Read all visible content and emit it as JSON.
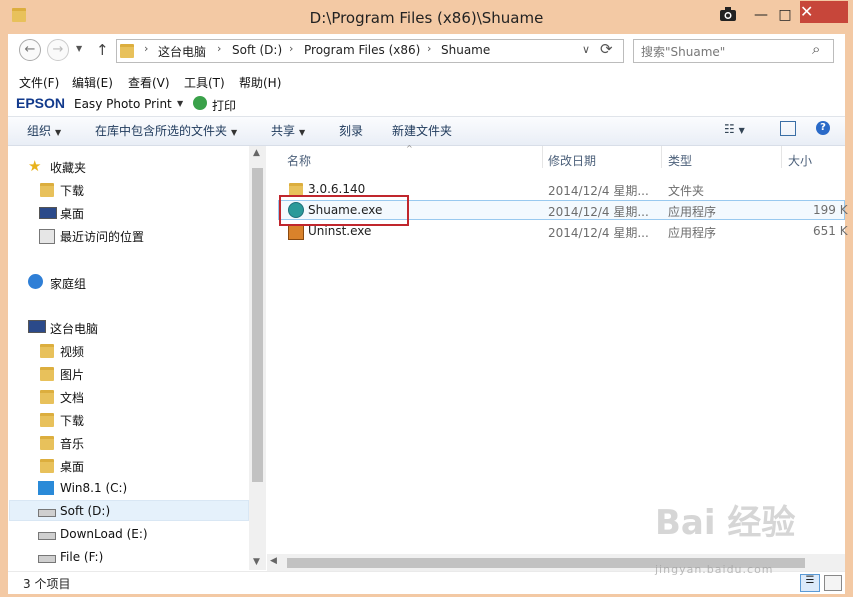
{
  "window": {
    "title": "D:\\Program Files (x86)\\Shuame",
    "camera_icon": "camera-icon",
    "min": "—",
    "max": "□",
    "close": "✕"
  },
  "nav_buttons": {
    "back": "←",
    "forward": "→",
    "up": "↑"
  },
  "breadcrumb": [
    "这台电脑",
    "Soft (D:)",
    "Program Files (x86)",
    "Shuame"
  ],
  "address": {
    "dropdown": "∨",
    "refresh": "⟳"
  },
  "search": {
    "placeholder": "搜索\"Shuame\"",
    "icon": "⌕"
  },
  "menu": [
    "文件(F)",
    "编辑(E)",
    "查看(V)",
    "工具(T)",
    "帮助(H)"
  ],
  "epson": {
    "brand": "EPSON",
    "app": "Easy Photo Print",
    "print": "打印"
  },
  "commands": {
    "organize": "组织",
    "include_library": "在库中包含所选的文件夹",
    "share": "共享",
    "burn": "刻录",
    "new_folder": "新建文件夹"
  },
  "nav_pane": {
    "favorites": "收藏夹",
    "fav_items": [
      "下载",
      "桌面",
      "最近访问的位置"
    ],
    "homegroup": "家庭组",
    "this_pc": "这台电脑",
    "pc_items": [
      "视频",
      "图片",
      "文档",
      "下载",
      "音乐",
      "桌面",
      "Win8.1 (C:)",
      "Soft (D:)",
      "DownLoad (E:)",
      "File (F:)"
    ]
  },
  "columns": [
    "名称",
    "修改日期",
    "类型",
    "大小"
  ],
  "files": [
    {
      "name": "3.0.6.140",
      "date": "2014/12/4 星期...",
      "type": "文件夹",
      "size": ""
    },
    {
      "name": "Shuame.exe",
      "date": "2014/12/4 星期...",
      "type": "应用程序",
      "size": "199 K"
    },
    {
      "name": "Uninst.exe",
      "date": "2014/12/4 星期...",
      "type": "应用程序",
      "size": "651 K"
    }
  ],
  "status": {
    "count": "3 个项目"
  },
  "watermark": {
    "text": "Bai 经验",
    "url": "jingyan.baidu.com"
  },
  "colors": {
    "titlebar": "#f3c9a4",
    "close": "#c7463a",
    "highlight": "#c0262d",
    "selection": "#e5f1fb"
  }
}
